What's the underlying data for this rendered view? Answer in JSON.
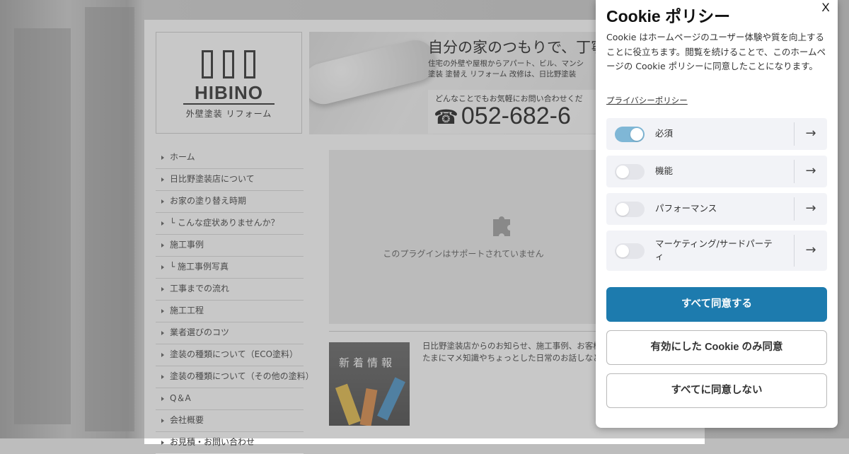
{
  "site": {
    "logo": {
      "name": "HIBINO",
      "sub": "外壁塗装 リフォーム"
    },
    "banner": {
      "headline": "自分の家のつもりで、丁寧",
      "sub_line1": "住宅の外壁や屋根からアパート、ビル、マンシ",
      "sub_line2": "塗装 塗替え リフォーム 改修は、日比野塗装",
      "phone_label": "どんなことでもお気軽にお問い合わせくだ",
      "phone_icon": "☎",
      "phone_number": "052-682-6"
    },
    "nav": [
      "ホーム",
      "日比野塗装店について",
      "お家の塗り替え時期",
      "└ こんな症状ありませんか？",
      "施工事例",
      "└ 施工事例写真",
      "工事までの流れ",
      "施工工程",
      "業者選びのコツ",
      "塗装の種類について（ECO塗料）",
      "塗装の種類について（その他の塗料）",
      "Q＆A",
      "会社概要",
      "お見積・お問い合わせ"
    ],
    "plugin_message": "このプラグインはサポートされていません",
    "news": {
      "image_label": "新着情報",
      "text_line1": "日比野塗装店からのお知らせ、施工事例、お客様",
      "text_line2": "たまにマメ知識やちょっとした日常のお話しなど"
    }
  },
  "cookie": {
    "title": "Cookie ポリシー",
    "close_label": "X",
    "description": "Cookie はホームページのユーザー体験や質を向上することに役立ちます。閲覧を続けることで、このホームページの Cookie ポリシーに同意したことになります。",
    "privacy_link": "プライバシーポリシー",
    "categories": [
      {
        "label": "必須",
        "enabled": true
      },
      {
        "label": "機能",
        "enabled": false
      },
      {
        "label": "パフォーマンス",
        "enabled": false
      },
      {
        "label": "マーケティング/サードパーティ",
        "enabled": false
      }
    ],
    "arrow_icon": "→",
    "buttons": {
      "accept_all": "すべて同意する",
      "accept_selected": "有効にした Cookie のみ同意",
      "reject_all": "すべてに同意しない"
    },
    "accent_color": "#1d7bae",
    "toggle_on_color": "#7fb7d6"
  }
}
